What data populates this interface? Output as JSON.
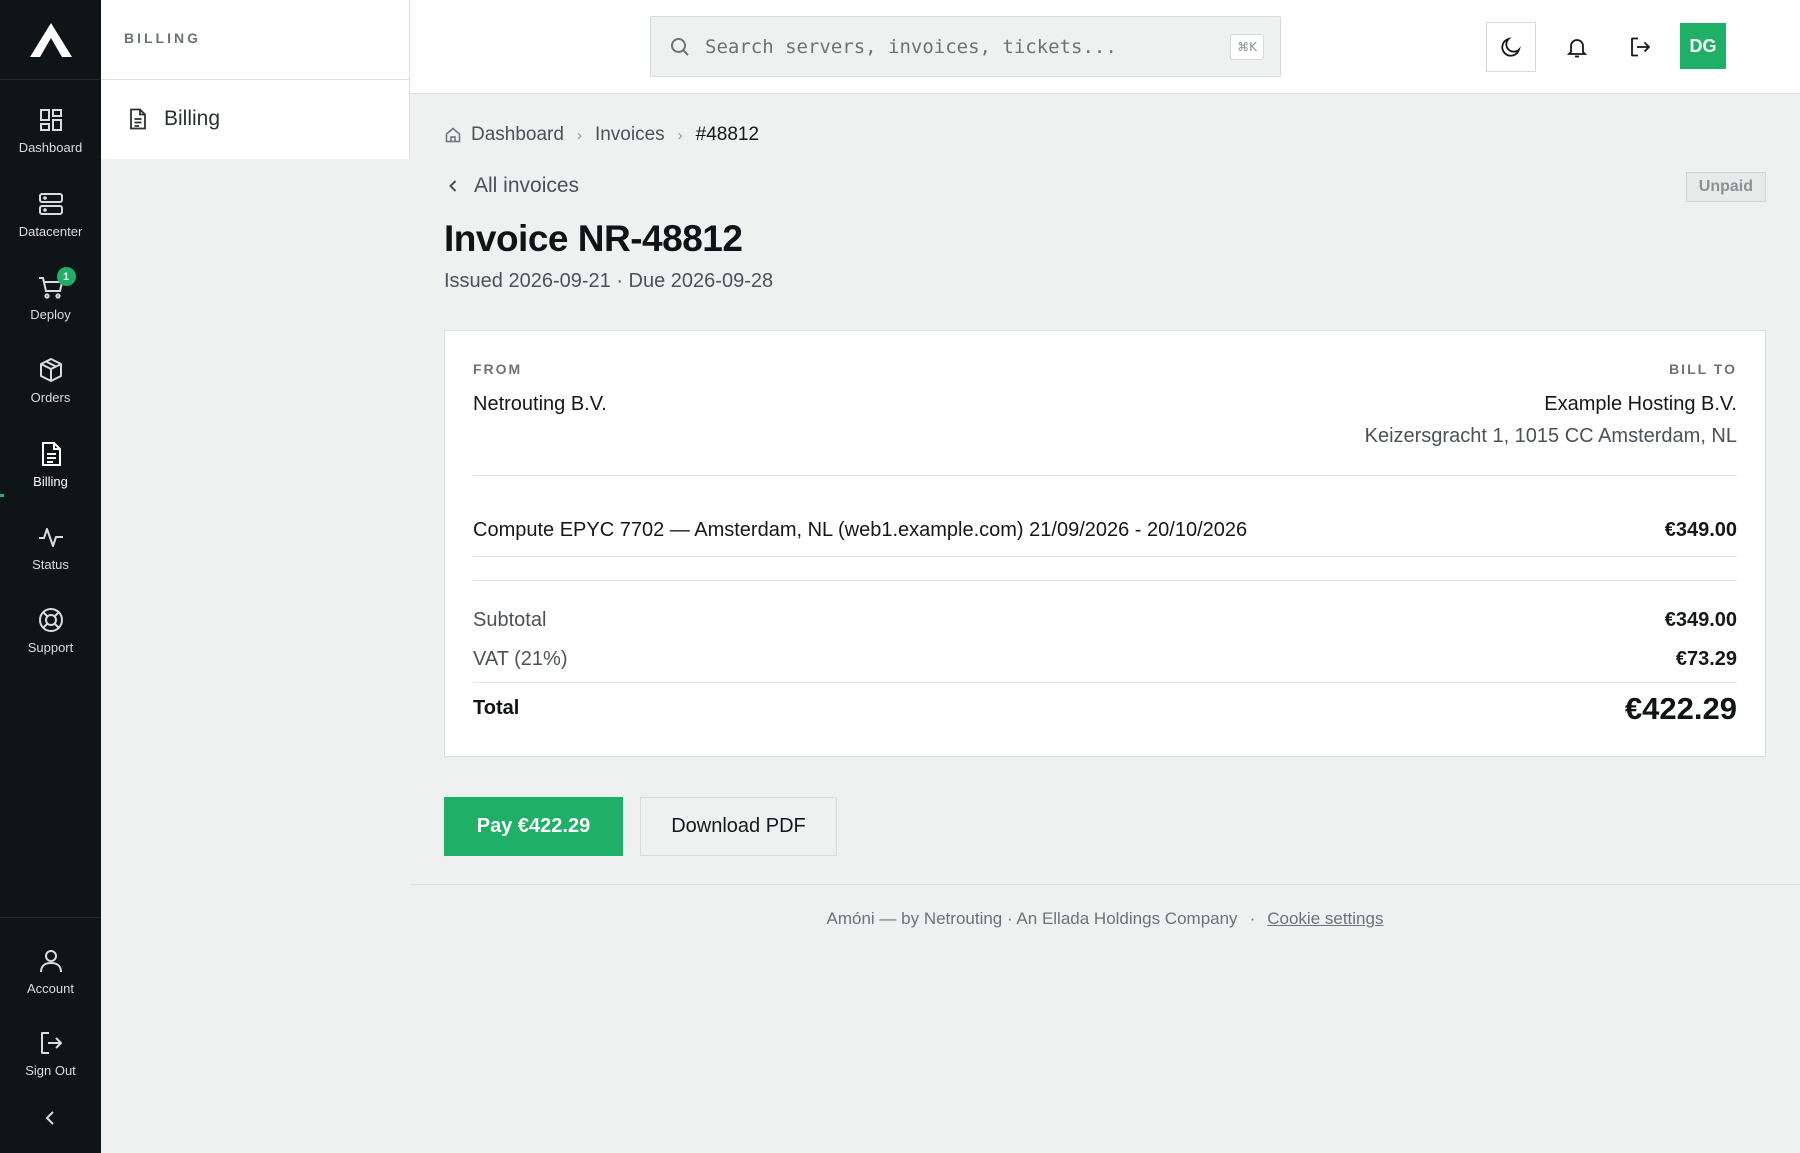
{
  "brand": {
    "accent": "#1fb067",
    "rail_bg": "#0f1417"
  },
  "rail": {
    "items": [
      {
        "label": "Dashboard",
        "icon": "grid-icon"
      },
      {
        "label": "Datacenter",
        "icon": "server-icon"
      },
      {
        "label": "Deploy",
        "icon": "cart-icon",
        "badge": "1"
      },
      {
        "label": "Orders",
        "icon": "box-icon"
      },
      {
        "label": "Billing",
        "icon": "document-icon",
        "active": true
      },
      {
        "label": "Status",
        "icon": "pulse-icon"
      },
      {
        "label": "Support",
        "icon": "lifebuoy-icon"
      }
    ],
    "bottom": [
      {
        "label": "Account",
        "icon": "user-icon"
      },
      {
        "label": "Sign Out",
        "icon": "signout-icon"
      }
    ]
  },
  "subnav": {
    "heading": "BILLING",
    "items": [
      {
        "label": "Billing",
        "icon": "document-icon"
      }
    ]
  },
  "topbar": {
    "search_placeholder": "Search servers, invoices, tickets...",
    "shortcut": "⌘K",
    "avatar": "DG"
  },
  "breadcrumb": [
    "Dashboard",
    "Invoices",
    "#48812"
  ],
  "back_label": "All invoices",
  "status": "Unpaid",
  "invoice": {
    "title": "Invoice NR-48812",
    "meta": "Issued 2026-09-21 · Due 2026-09-28",
    "from_label": "FROM",
    "from_name": "Netrouting B.V.",
    "to_label": "BILL TO",
    "to_name": "Example Hosting B.V.",
    "to_address": "Keizersgracht 1, 1015 CC Amsterdam, NL",
    "line": {
      "description": "Compute EPYC 7702 — Amsterdam, NL (web1.example.com) 21/09/2026 - 20/10/2026",
      "amount": "€349.00"
    },
    "subtotal_label": "Subtotal",
    "subtotal": "€349.00",
    "vat_label": "VAT (21%)",
    "vat": "€73.29",
    "total_label": "Total",
    "total": "€422.29"
  },
  "actions": {
    "pay": "Pay €422.29",
    "download": "Download PDF"
  },
  "footer": {
    "text": "Amóni — by Netrouting · An Ellada Holdings Company",
    "sep": "·",
    "cookie": "Cookie settings"
  }
}
